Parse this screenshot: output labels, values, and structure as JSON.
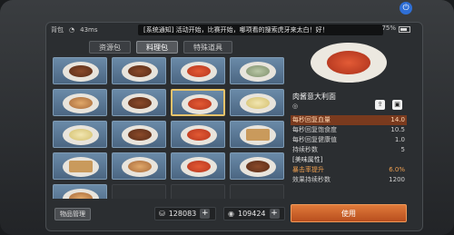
{
  "status": {
    "carrier": "背包",
    "network": "43ms",
    "marquee": "[系统通知] 活动开始，比赛开始，哪项看的搜索虎牙来太白！好！",
    "battery": "75%"
  },
  "tabs": [
    {
      "label": "资源包",
      "active": false
    },
    {
      "label": "料理包",
      "active": true
    },
    {
      "label": "特殊道具",
      "active": false
    }
  ],
  "grid": [
    {
      "food": "steak",
      "count": ""
    },
    {
      "food": "steak",
      "count": ""
    },
    {
      "food": "pasta",
      "count": ""
    },
    {
      "food": "stew",
      "count": ""
    },
    {
      "food": "roll",
      "count": ""
    },
    {
      "food": "steak",
      "count": ""
    },
    {
      "food": "pasta",
      "count": "",
      "selected": true
    },
    {
      "food": "cake",
      "count": ""
    },
    {
      "food": "cake",
      "count": ""
    },
    {
      "food": "steak",
      "count": ""
    },
    {
      "food": "pasta",
      "count": ""
    },
    {
      "food": "box",
      "count": ""
    },
    {
      "food": "box",
      "count": ""
    },
    {
      "food": "roll",
      "count": ""
    },
    {
      "food": "pasta",
      "count": ""
    },
    {
      "food": "steak",
      "count": ""
    },
    {
      "food": "roll",
      "count": ""
    },
    {
      "food": "empty",
      "count": ""
    },
    {
      "food": "empty",
      "count": ""
    },
    {
      "food": "empty",
      "count": ""
    }
  ],
  "bottom": {
    "manage_label": "物品管理",
    "currency1": "128083",
    "currency2": "109424"
  },
  "detail": {
    "name": "肉酱意大利面",
    "stats": [
      {
        "label": "每秒回复血量",
        "value": "14.0",
        "style": "hl"
      },
      {
        "label": "每秒回复饱食度",
        "value": "10.5",
        "style": ""
      },
      {
        "label": "每秒回复健康值",
        "value": "1.0",
        "style": ""
      },
      {
        "label": "持续秒数",
        "value": "5",
        "style": ""
      },
      {
        "label": "[美味属性]",
        "value": "",
        "style": "section"
      },
      {
        "label": "暴击率提升",
        "value": "6.0%",
        "style": "orange"
      },
      {
        "label": "效果持续秒数",
        "value": "1200",
        "style": ""
      }
    ],
    "use_label": "使用"
  }
}
